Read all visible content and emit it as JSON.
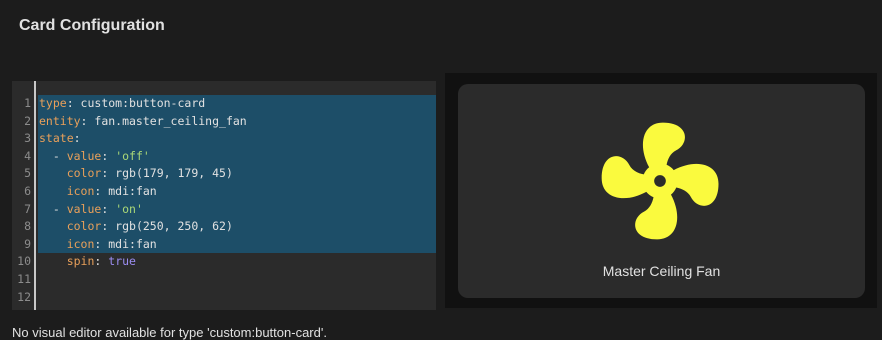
{
  "header": {
    "title": "Card Configuration"
  },
  "editor": {
    "lines": [
      {
        "num": "1",
        "tokens": [
          {
            "t": "type",
            "c": "key"
          },
          {
            "t": ": custom:button-card",
            "c": "plain"
          }
        ]
      },
      {
        "num": "2",
        "tokens": [
          {
            "t": "entity",
            "c": "key"
          },
          {
            "t": ": fan.master_ceiling_fan",
            "c": "plain"
          }
        ]
      },
      {
        "num": "3",
        "tokens": [
          {
            "t": "state",
            "c": "key"
          },
          {
            "t": ":",
            "c": "plain"
          }
        ]
      },
      {
        "num": "4",
        "tokens": [
          {
            "t": "  - ",
            "c": "plain"
          },
          {
            "t": "value",
            "c": "key"
          },
          {
            "t": ": ",
            "c": "plain"
          },
          {
            "t": "'off'",
            "c": "str"
          }
        ]
      },
      {
        "num": "5",
        "tokens": [
          {
            "t": "    ",
            "c": "plain"
          },
          {
            "t": "color",
            "c": "key"
          },
          {
            "t": ": rgb(179, 179, 45)",
            "c": "plain"
          }
        ]
      },
      {
        "num": "6",
        "tokens": [
          {
            "t": "    ",
            "c": "plain"
          },
          {
            "t": "icon",
            "c": "key"
          },
          {
            "t": ": mdi:fan",
            "c": "plain"
          }
        ]
      },
      {
        "num": "7",
        "tokens": [
          {
            "t": "  - ",
            "c": "plain"
          },
          {
            "t": "value",
            "c": "key"
          },
          {
            "t": ": ",
            "c": "plain"
          },
          {
            "t": "'on'",
            "c": "str"
          }
        ]
      },
      {
        "num": "8",
        "tokens": [
          {
            "t": "    ",
            "c": "plain"
          },
          {
            "t": "color",
            "c": "key"
          },
          {
            "t": ": rgb(250, 250, 62)",
            "c": "plain"
          }
        ]
      },
      {
        "num": "9",
        "tokens": [
          {
            "t": "    ",
            "c": "plain"
          },
          {
            "t": "icon",
            "c": "key"
          },
          {
            "t": ": mdi:fan",
            "c": "plain"
          }
        ]
      },
      {
        "num": "10",
        "tokens": [
          {
            "t": "    ",
            "c": "plain"
          },
          {
            "t": "spin",
            "c": "key"
          },
          {
            "t": ": ",
            "c": "plain"
          },
          {
            "t": "true",
            "c": "bool"
          }
        ]
      },
      {
        "num": "11",
        "tokens": []
      },
      {
        "num": "12",
        "tokens": []
      }
    ]
  },
  "preview": {
    "card_name": "Master Ceiling Fan",
    "icon": "fan-icon",
    "icon_color": "#fafa3e"
  },
  "footer": {
    "message": "No visual editor available for type 'custom:button-card'."
  }
}
